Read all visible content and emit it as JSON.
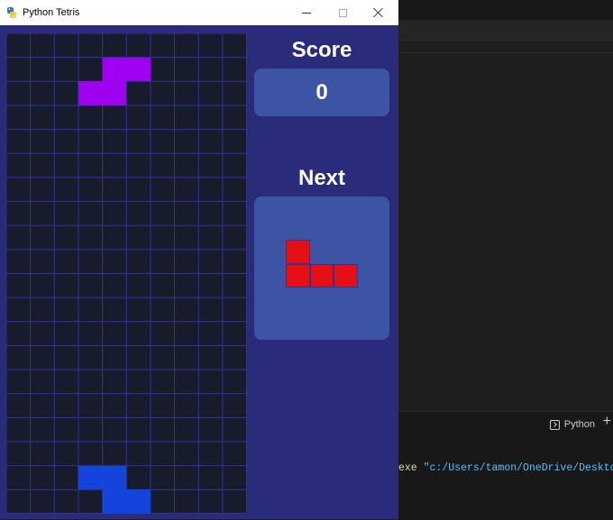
{
  "window": {
    "title": "Python Tetris"
  },
  "labels": {
    "score": "Score",
    "next": "Next"
  },
  "score": "0",
  "board": {
    "cols": 10,
    "rows": 20,
    "pieces": [
      {
        "name": "falling-piece",
        "color": "#a000f0",
        "cells": [
          [
            4,
            1
          ],
          [
            5,
            1
          ],
          [
            3,
            2
          ],
          [
            4,
            2
          ]
        ]
      },
      {
        "name": "placed-piece",
        "color": "#1444dc",
        "cells": [
          [
            3,
            18
          ],
          [
            4,
            18
          ],
          [
            4,
            19
          ],
          [
            5,
            19
          ]
        ]
      }
    ]
  },
  "next_piece": {
    "name": "next-piece",
    "color": "#e60f16",
    "cells": [
      [
        0,
        0
      ],
      [
        0,
        1
      ],
      [
        1,
        1
      ],
      [
        2,
        1
      ]
    ]
  },
  "editor": {
    "terminal_tab": "Python",
    "terminal_plus": "+",
    "terminal_line_prefix": "exe ",
    "terminal_line_path": "\"c:/Users/tamon/OneDrive/Desktop/py"
  },
  "colors": {
    "window_bg": "#2b2b7c",
    "board_bg": "#171b2b",
    "panel_bg": "#3c54a3",
    "grid_line": "#2e3599"
  }
}
